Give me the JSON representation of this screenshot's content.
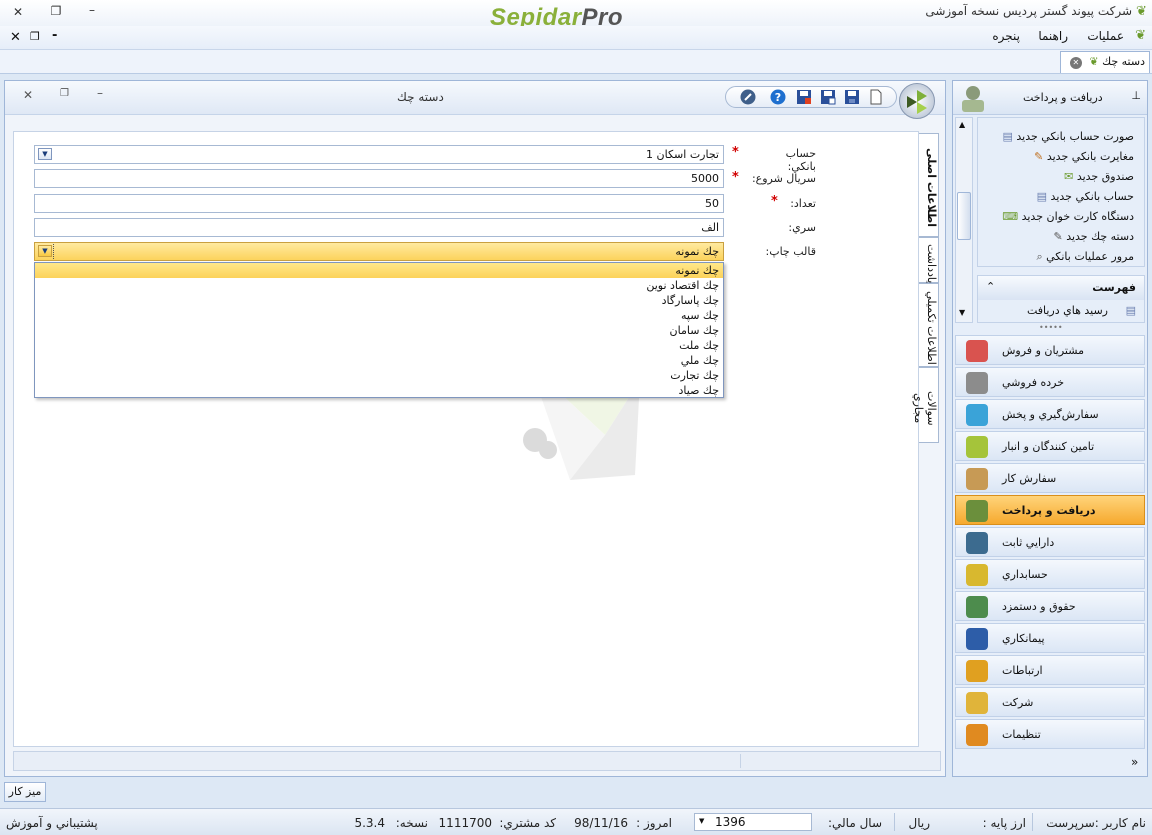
{
  "app": {
    "brand_main": "Sepidar",
    "brand_suffix": "Pro",
    "title": "شرکت پیوند گستر پردیس نسخه آموزشی"
  },
  "menu": {
    "items": [
      "عملیات",
      "راهنما",
      "پنجره"
    ]
  },
  "tabs": {
    "doc_tab_label": "دسته چك"
  },
  "child": {
    "title": "دسته چك"
  },
  "form": {
    "bank_account_label": "حساب بانكي:",
    "bank_account_value": "تجارت اسكان 1",
    "start_serial_label": "سريال شروع:",
    "start_serial_value": "5000",
    "count_label": "تعداد:",
    "count_value": "50",
    "series_label": "سري:",
    "series_value": "الف",
    "print_template_label": "قالب چاپ:",
    "print_template_value": "چك نمونه",
    "required_mark": "*"
  },
  "dropdown": {
    "options": [
      "چك نمونه",
      "چك اقتصاد نوين",
      "چك پاسارگاد",
      "چك سپه",
      "چك سامان",
      "چك ملت",
      "چك ملي",
      "چك تجارت",
      "چك صياد"
    ],
    "selected_index": 0
  },
  "vertical_tabs": [
    "اطلاعات اصلی",
    "يادداشت",
    "اطلاعات تكميلي",
    "سوالات مجاري"
  ],
  "right_panel": {
    "header": "دريافت و پرداخت",
    "sublinks": [
      "صورت حساب بانكي جديد",
      "مغايرت بانكي جديد",
      "صندوق جديد",
      "حساب بانكي جديد",
      "دستگاه كارت خوان جديد",
      "دسته چك جديد",
      "مرور عمليات بانكي"
    ],
    "list_header": "فهرست",
    "list_items": [
      "رسيد هاي دريافت"
    ],
    "nav": [
      {
        "label": "مشتريان و فروش",
        "icon": "chart-icon",
        "color": "#d9534f"
      },
      {
        "label": "خرده فروشي",
        "icon": "cart-icon",
        "color": "#8c8c8c"
      },
      {
        "label": "سفارش‌گيري و پخش",
        "icon": "globe-icon",
        "color": "#3aa3d8"
      },
      {
        "label": "تامين كنندگان و انبار",
        "icon": "boxes-icon",
        "color": "#a5c43a"
      },
      {
        "label": "سفارش كار",
        "icon": "parts-icon",
        "color": "#c79a55"
      },
      {
        "label": "دريافت و پرداخت",
        "icon": "cashier-icon",
        "color": "#6b8f3c",
        "active": true
      },
      {
        "label": "دارايي ثابت",
        "icon": "machine-icon",
        "color": "#3c6b8f"
      },
      {
        "label": "حسابداري",
        "icon": "ledger-icon",
        "color": "#d8b82f"
      },
      {
        "label": "حقوق و دستمزد",
        "icon": "money-icon",
        "color": "#4d8c4d"
      },
      {
        "label": "پيمانكاري",
        "icon": "handshake-icon",
        "color": "#2d5da8"
      },
      {
        "label": "ارتباطات",
        "icon": "arrows-icon",
        "color": "#e0a020"
      },
      {
        "label": "شركت",
        "icon": "company-icon",
        "color": "#e0b43a"
      },
      {
        "label": "تنظيمات",
        "icon": "gear-icon",
        "color": "#e08a20"
      }
    ]
  },
  "taskbar": {
    "desk_label": "ميز كار"
  },
  "status": {
    "user_label": "نام کاربر :سرپرست",
    "base_currency_label": "ارز پایه :",
    "base_currency_value": "ريال",
    "fiscal_year_label": "سال مالي:",
    "fiscal_year_value": "1396",
    "today_label": "امروز :",
    "today_value": "98/11/16",
    "customer_code_label": "كد مشتري:",
    "customer_code_value": "1111700",
    "version_label": "نسخه:",
    "version_value": "5.3.4",
    "support_label": "پشتيباني و آموزش"
  }
}
